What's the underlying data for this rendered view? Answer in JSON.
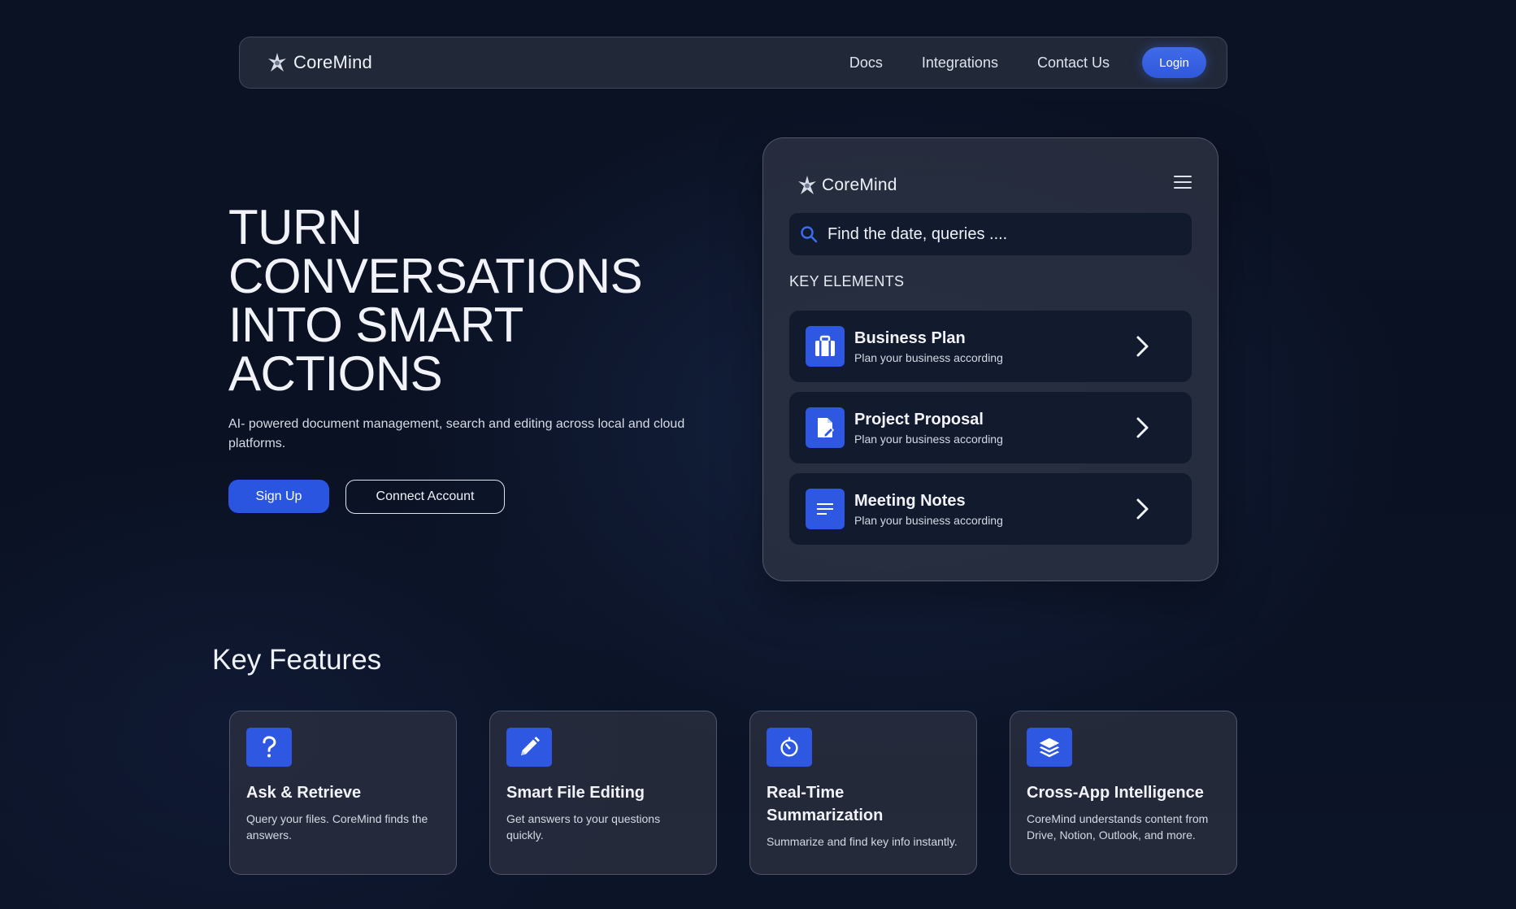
{
  "nav": {
    "brand": "CoreMind",
    "links": [
      "Docs",
      "Integrations",
      "Contact Us"
    ],
    "login_label": "Login"
  },
  "hero": {
    "title_lines": [
      "TURN",
      "CONVERSATIONS",
      "INTO SMART",
      "ACTIONS"
    ],
    "subtitle": "AI- powered document management, search and editing across local and cloud platforms.",
    "primary_label": "Sign Up",
    "secondary_label": "Connect Account"
  },
  "panel": {
    "brand": "CoreMind",
    "search_placeholder": "Find the date, queries ....",
    "section_label": "KEY ELEMENTS",
    "items": [
      {
        "title": "Business Plan",
        "desc": "Plan your business according",
        "icon": "briefcase-icon"
      },
      {
        "title": "Project Proposal",
        "desc": "Plan your business according",
        "icon": "document-edit-icon"
      },
      {
        "title": "Meeting Notes",
        "desc": "Plan your business according",
        "icon": "notes-lines-icon"
      }
    ]
  },
  "features": {
    "title": "Key Features",
    "cards": [
      {
        "title": "Ask & Retrieve",
        "desc": "Query your files. CoreMind finds the answers.",
        "icon": "question-icon"
      },
      {
        "title": "Smart File Editing",
        "desc": "Get answers to your questions quickly.",
        "icon": "pencil-icon"
      },
      {
        "title": "Real-Time Summarization",
        "desc": "Summarize and find key info instantly.",
        "icon": "timer-icon"
      },
      {
        "title": "Cross-App Intelligence",
        "desc": "CoreMind understands content from Drive, Notion, Outlook, and more.",
        "icon": "layers-icon"
      }
    ]
  },
  "colors": {
    "accent": "#2e57e2",
    "login_button": "#3f6ae8",
    "background": "#0b1224",
    "panel": "#2c3242",
    "input_bg": "#121a2e"
  }
}
